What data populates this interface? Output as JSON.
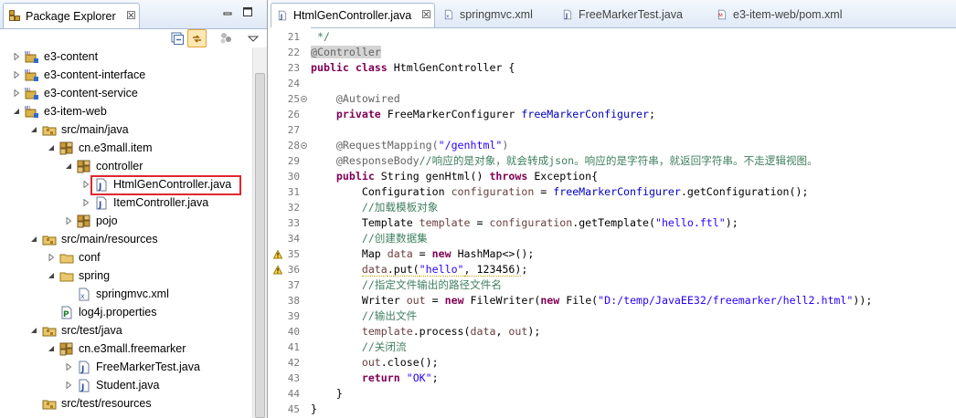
{
  "package_explorer": {
    "tab_title": "Package Explorer",
    "close_glyph": "☒",
    "tree": [
      {
        "label": "e3-content",
        "icon": "maven-project-icon",
        "depth": 0,
        "expanded": false
      },
      {
        "label": "e3-content-interface",
        "icon": "maven-project-icon",
        "depth": 0,
        "expanded": false
      },
      {
        "label": "e3-content-service",
        "icon": "maven-project-icon",
        "depth": 0,
        "expanded": false
      },
      {
        "label": "e3-item-web",
        "icon": "maven-project-icon",
        "depth": 0,
        "expanded": true
      },
      {
        "label": "src/main/java",
        "icon": "source-folder-icon",
        "depth": 1,
        "expanded": true
      },
      {
        "label": "cn.e3mall.item",
        "icon": "package-icon",
        "depth": 2,
        "expanded": true
      },
      {
        "label": "controller",
        "icon": "package-icon",
        "depth": 3,
        "expanded": true
      },
      {
        "label": "HtmlGenController.java",
        "icon": "java-file-icon",
        "depth": 4,
        "expanded": false,
        "selected": true
      },
      {
        "label": "ItemController.java",
        "icon": "java-file-icon",
        "depth": 4,
        "expanded": false
      },
      {
        "label": "pojo",
        "icon": "package-icon",
        "depth": 3,
        "expanded": false
      },
      {
        "label": "src/main/resources",
        "icon": "source-folder-icon",
        "depth": 1,
        "expanded": true
      },
      {
        "label": "conf",
        "icon": "folder-icon",
        "depth": 2,
        "expanded": false
      },
      {
        "label": "spring",
        "icon": "folder-icon",
        "depth": 2,
        "expanded": true
      },
      {
        "label": "springmvc.xml",
        "icon": "xml-file-icon",
        "depth": 3,
        "expanded": null
      },
      {
        "label": "log4j.properties",
        "icon": "properties-file-icon",
        "depth": 2,
        "expanded": null
      },
      {
        "label": "src/test/java",
        "icon": "source-folder-icon",
        "depth": 1,
        "expanded": true
      },
      {
        "label": "cn.e3mall.freemarker",
        "icon": "package-icon",
        "depth": 2,
        "expanded": true
      },
      {
        "label": "FreeMarkerTest.java",
        "icon": "java-file-icon",
        "depth": 3,
        "expanded": false
      },
      {
        "label": "Student.java",
        "icon": "java-file-icon",
        "depth": 3,
        "expanded": false
      },
      {
        "label": "src/test/resources",
        "icon": "source-folder-icon",
        "depth": 1,
        "expanded": null
      }
    ]
  },
  "editor": {
    "tabs": [
      {
        "label": "HtmlGenController.java",
        "icon": "java-file-icon",
        "active": true,
        "close_glyph": "☒"
      },
      {
        "label": "springmvc.xml",
        "icon": "xml-file-icon",
        "active": false
      },
      {
        "label": "FreeMarkerTest.java",
        "icon": "java-file-icon",
        "active": false
      },
      {
        "label": "e3-item-web/pom.xml",
        "icon": "maven-pom-icon",
        "active": false
      }
    ],
    "lines": [
      {
        "n": "21",
        "tokens": [
          [
            "cm",
            " */"
          ]
        ]
      },
      {
        "n": "22",
        "tokens": [
          [
            "ann hl",
            "@Controller"
          ]
        ]
      },
      {
        "n": "23",
        "tokens": [
          [
            "kw",
            "public"
          ],
          [
            "",
            " "
          ],
          [
            "kw",
            "class"
          ],
          [
            "",
            " HtmlGenController {"
          ]
        ]
      },
      {
        "n": "24",
        "tokens": []
      },
      {
        "n": "25",
        "fold": true,
        "tokens": [
          [
            "",
            "    "
          ],
          [
            "ann",
            "@Autowired"
          ]
        ]
      },
      {
        "n": "26",
        "tokens": [
          [
            "",
            "    "
          ],
          [
            "kw",
            "private"
          ],
          [
            "",
            " FreeMarkerConfigurer "
          ],
          [
            "fld",
            "freeMarkerConfigurer"
          ],
          [
            "",
            ";"
          ]
        ]
      },
      {
        "n": "27",
        "tokens": []
      },
      {
        "n": "28",
        "fold": true,
        "tokens": [
          [
            "",
            "    "
          ],
          [
            "ann",
            "@RequestMapping("
          ],
          [
            "str",
            "\"/genhtml\""
          ],
          [
            "ann",
            ")"
          ]
        ]
      },
      {
        "n": "29",
        "tokens": [
          [
            "",
            "    "
          ],
          [
            "ann",
            "@ResponseBody"
          ],
          [
            "cm",
            "//响应的是对象，就会转成json。响应的是字符串，就返回字符串。不走逻辑视图。"
          ]
        ]
      },
      {
        "n": "30",
        "tokens": [
          [
            "",
            "    "
          ],
          [
            "kw",
            "public"
          ],
          [
            "",
            " String genHtml() "
          ],
          [
            "kw",
            "throws"
          ],
          [
            "",
            " Exception{"
          ]
        ]
      },
      {
        "n": "31",
        "tokens": [
          [
            "",
            "        Configuration "
          ],
          [
            "var",
            "configuration"
          ],
          [
            "",
            " = "
          ],
          [
            "fld",
            "freeMarkerConfigurer"
          ],
          [
            "",
            ".getConfiguration();"
          ]
        ]
      },
      {
        "n": "32",
        "tokens": [
          [
            "",
            "        "
          ],
          [
            "cm",
            "//加载模板对象"
          ]
        ]
      },
      {
        "n": "33",
        "tokens": [
          [
            "",
            "        Template "
          ],
          [
            "var",
            "template"
          ],
          [
            "",
            " = "
          ],
          [
            "var",
            "configuration"
          ],
          [
            "",
            ".getTemplate("
          ],
          [
            "str",
            "\"hello.ftl\""
          ],
          [
            "",
            ");"
          ]
        ]
      },
      {
        "n": "34",
        "tokens": [
          [
            "",
            "        "
          ],
          [
            "cm",
            "//创建数据集"
          ]
        ]
      },
      {
        "n": "35",
        "warn": true,
        "tokens": [
          [
            "",
            "        Map "
          ],
          [
            "var",
            "data"
          ],
          [
            "",
            " = "
          ],
          [
            "kw",
            "new"
          ],
          [
            "",
            " HashMap<>();"
          ]
        ]
      },
      {
        "n": "36",
        "warn": true,
        "tokens": [
          [
            "",
            "        "
          ],
          [
            "var sq",
            "data"
          ],
          [
            "sq",
            ".put("
          ],
          [
            "str sq",
            "\"hello\""
          ],
          [
            "sq",
            ", 123456)"
          ],
          [
            "",
            ";"
          ]
        ]
      },
      {
        "n": "37",
        "tokens": [
          [
            "",
            "        "
          ],
          [
            "cm",
            "//指定文件输出的路径文件名"
          ]
        ]
      },
      {
        "n": "38",
        "tokens": [
          [
            "",
            "        Writer "
          ],
          [
            "var",
            "out"
          ],
          [
            "",
            " = "
          ],
          [
            "kw",
            "new"
          ],
          [
            "",
            " FileWriter("
          ],
          [
            "kw",
            "new"
          ],
          [
            "",
            " File("
          ],
          [
            "str",
            "\"D:/temp/JavaEE32/freemarker/hell2.html\""
          ],
          [
            "",
            "));"
          ]
        ]
      },
      {
        "n": "39",
        "tokens": [
          [
            "",
            "        "
          ],
          [
            "cm",
            "//输出文件"
          ]
        ]
      },
      {
        "n": "40",
        "tokens": [
          [
            "",
            "        "
          ],
          [
            "var",
            "template"
          ],
          [
            "",
            ".process("
          ],
          [
            "var",
            "data"
          ],
          [
            "",
            ", "
          ],
          [
            "var",
            "out"
          ],
          [
            "",
            ");"
          ]
        ]
      },
      {
        "n": "41",
        "tokens": [
          [
            "",
            "        "
          ],
          [
            "cm",
            "//关闭流"
          ]
        ]
      },
      {
        "n": "42",
        "tokens": [
          [
            "",
            "        "
          ],
          [
            "var",
            "out"
          ],
          [
            "",
            ".close();"
          ]
        ]
      },
      {
        "n": "43",
        "tokens": [
          [
            "",
            "        "
          ],
          [
            "kw",
            "return"
          ],
          [
            "",
            " "
          ],
          [
            "str",
            "\"OK\""
          ],
          [
            "",
            ";"
          ]
        ]
      },
      {
        "n": "44",
        "tokens": [
          [
            "",
            "    }"
          ]
        ]
      },
      {
        "n": "45",
        "tokens": [
          [
            "",
            "}"
          ]
        ]
      }
    ]
  },
  "colors": {
    "keyword": "#7f0055",
    "annotation": "#646464",
    "string": "#2a00ff",
    "comment": "#3f7f5f",
    "field": "#0000c0",
    "selection_box": "#e0262e"
  }
}
